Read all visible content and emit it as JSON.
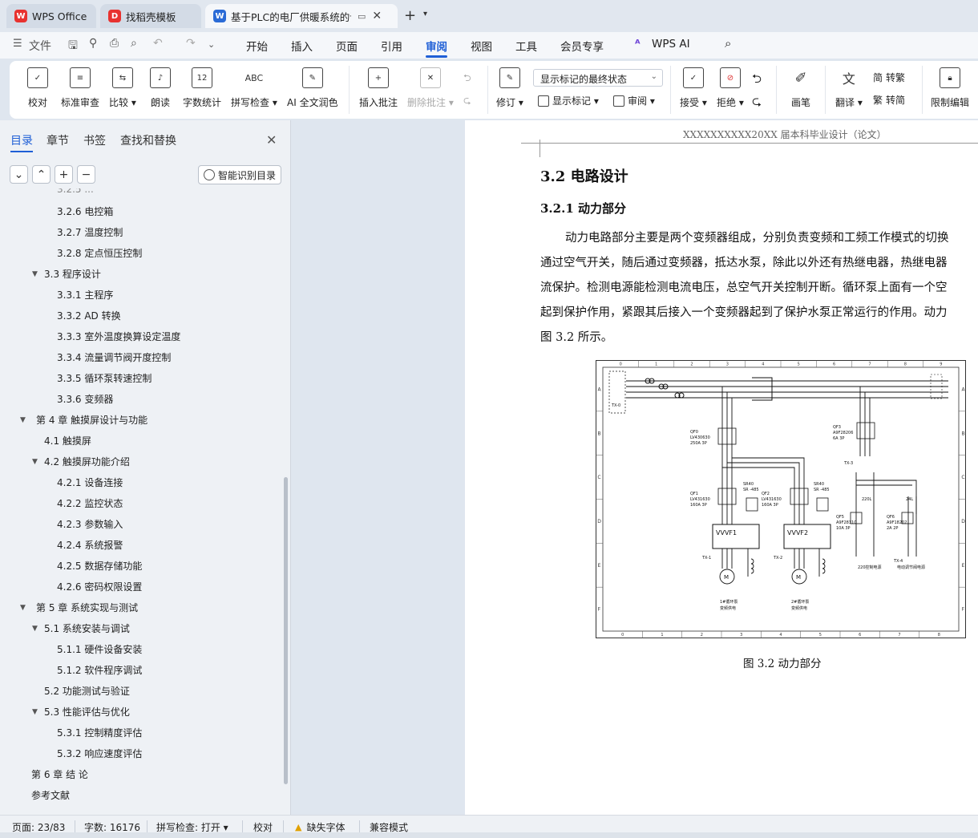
{
  "tabs": [
    {
      "label": "WPS Office",
      "icon": "wps-logo-icon"
    },
    {
      "label": "找稻壳模板",
      "icon": "docer-icon"
    },
    {
      "label": "基于PLC的电厂供暖系统的设计",
      "icon": "word-doc-icon"
    }
  ],
  "menubar": {
    "file_label": "文件",
    "tabs": [
      "开始",
      "插入",
      "页面",
      "引用",
      "审阅",
      "视图",
      "工具",
      "会员专享",
      "WPS AI"
    ],
    "active_tab": "审阅"
  },
  "ribbon": {
    "proofread": "校对",
    "standard_review": "标准审查",
    "compare": "比较",
    "read_aloud": "朗读",
    "word_count": "字数统计",
    "spell_check": "拼写检查",
    "ai_polish": "AI 全文润色",
    "insert_comment": "插入批注",
    "delete_comment": "删除批注",
    "revise": "修订",
    "markup_display": "显示标记的最终状态",
    "show_markup": "显示标记",
    "review": "审阅",
    "accept": "接受",
    "reject": "拒绝",
    "pen": "画笔",
    "translate": "翻译",
    "to_simplified": "转繁",
    "to_traditional": "转简",
    "restrict_edit": "限制编辑"
  },
  "sidebar": {
    "tabs": [
      "目录",
      "章节",
      "书签",
      "查找和替换"
    ],
    "smart_toc": "智能识别目录",
    "toc": [
      {
        "label": "3.2.6  电控箱",
        "level": 3
      },
      {
        "label": "3.2.7  温度控制",
        "level": 3
      },
      {
        "label": "3.2.8  定点恒压控制",
        "level": 3
      },
      {
        "label": "3.3  程序设计",
        "level": 2,
        "expanded": true
      },
      {
        "label": "3.3.1  主程序",
        "level": 3
      },
      {
        "label": "3.3.2 AD 转换",
        "level": 3
      },
      {
        "label": "3.3.3  室外温度换算设定温度",
        "level": 3
      },
      {
        "label": "3.3.4  流量调节阀开度控制",
        "level": 3
      },
      {
        "label": "3.3.5  循环泵转速控制",
        "level": 3
      },
      {
        "label": "3.3.6  变频器",
        "level": 3
      },
      {
        "label": "第 4 章    触摸屏设计与功能",
        "level": 1,
        "expanded": true
      },
      {
        "label": "4.1  触摸屏",
        "level": 2
      },
      {
        "label": "4.2  触摸屏功能介绍",
        "level": 2,
        "expanded": true
      },
      {
        "label": "4.2.1  设备连接",
        "level": 3
      },
      {
        "label": "4.2.2  监控状态",
        "level": 3
      },
      {
        "label": "4.2.3  参数输入",
        "level": 3
      },
      {
        "label": "4.2.4  系统报警",
        "level": 3
      },
      {
        "label": "4.2.5  数据存储功能",
        "level": 3
      },
      {
        "label": "4.2.6  密码权限设置",
        "level": 3
      },
      {
        "label": "第 5 章    系统实现与测试",
        "level": 1,
        "expanded": true
      },
      {
        "label": "5.1  系统安装与调试",
        "level": 2,
        "expanded": true
      },
      {
        "label": "5.1.1  硬件设备安装",
        "level": 3
      },
      {
        "label": "5.1.2  软件程序调试",
        "level": 3
      },
      {
        "label": "5.2  功能测试与验证",
        "level": 2
      },
      {
        "label": "5.3 性能评估与优化",
        "level": 2,
        "expanded": true
      },
      {
        "label": "5.3.1  控制精度评估",
        "level": 3
      },
      {
        "label": "5.3.2  响应速度评估",
        "level": 3
      },
      {
        "label": "第 6 章    结    论",
        "level": 1
      },
      {
        "label": "参考文献",
        "level": 1
      }
    ]
  },
  "document": {
    "header": "XXXXXXXXXX20XX 届本科毕业设计（论文）",
    "section_title": "3.2  电路设计",
    "subsection_title": "3.2.1  动力部分",
    "paragraph_lines": [
      "动力电路部分主要是两个变频器组成，分别负责变频和工频工作模式的切换",
      "通过空气开关，随后通过变频器，抵达水泵，除此以外还有热继电器，热继电器",
      "流保护。检测电源能检测电流电压，总空气开关控制开断。循环泵上面有一个空",
      "起到保护作用，紧跟其后接入一个变频器起到了保护水泵正常运行的作用。动力",
      "图 3.2 所示。"
    ],
    "figure_caption": "图 3.2  动力部分",
    "figure": {
      "top_numbers": [
        "0",
        "1",
        "2",
        "3",
        "4",
        "5",
        "6",
        "7",
        "8",
        "9"
      ],
      "bottom_numbers": [
        "0",
        "1",
        "2",
        "3",
        "4",
        "5",
        "6",
        "7",
        "8"
      ],
      "row_letters": [
        "A",
        "B",
        "C",
        "D",
        "E",
        "F"
      ],
      "labels": {
        "qf0": "QF0",
        "qf0_model": "LV430630",
        "qf0_rating": "250A 3P",
        "qf1": "QF1",
        "qf1_model": "LV431630",
        "qf1_rating": "160A 3P",
        "qf2": "QF2",
        "qf2_model": "LV431630",
        "qf2_rating": "160A 3P",
        "qf3": "QF3",
        "qf3_model": "A9F28206",
        "qf3_rating": "6A 3P",
        "qf5": "QF5",
        "qf5_model": "A9F28310",
        "qf5_rating": "10A 3P",
        "qf6": "QF6",
        "qf6_model": "A9F18202",
        "qf6_rating": "2A 2P",
        "sr1": "SR40",
        "sr1b": "SR -485",
        "sr2": "SR40",
        "sr2b": "SR -485",
        "vvvf1": "VVVF1",
        "vvvf2": "VVVF2",
        "tx0": "TX-0",
        "tx1": "TX-1",
        "tx2": "TX-2",
        "tx3": "TX-3",
        "tx4": "TX-4",
        "motor": "M",
        "pump1a": "1#循环泵",
        "pump1b": "变频供电",
        "pump2a": "2#循环泵",
        "pump2b": "变频供电",
        "ctrl220": "220控制电源",
        "valve": "电动调节阀电源",
        "v220": "220L",
        "v24": "24L"
      }
    }
  },
  "statusbar": {
    "page": "页面: 23/83",
    "words": "字数: 16176",
    "spell": "拼写检查: 打开",
    "proof": "校对",
    "missing_font": "缺失字体",
    "compat": "兼容模式"
  },
  "colors": {
    "accent": "#1f5fd6",
    "wps_red": "#e8322f",
    "word_blue": "#2b6bd6"
  }
}
